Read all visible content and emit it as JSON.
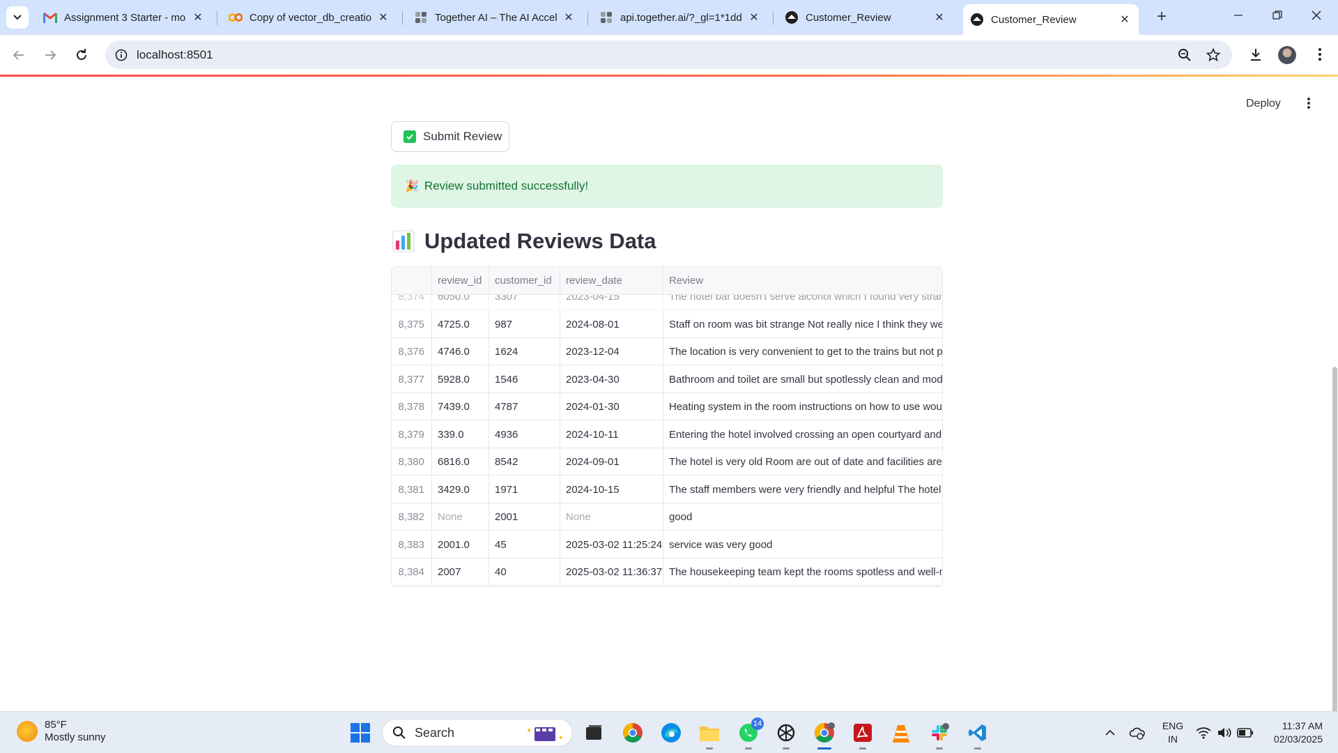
{
  "browser": {
    "tabs": [
      {
        "title": "Assignment 3 Starter - mo",
        "icon": "gmail-icon"
      },
      {
        "title": "Copy of vector_db_creatio",
        "icon": "colab-icon"
      },
      {
        "title": "Together AI – The AI Accel",
        "icon": "together-icon"
      },
      {
        "title": "api.together.ai/?_gl=1*1dd",
        "icon": "together-icon"
      },
      {
        "title": "Customer_Review",
        "icon": "streamlit-icon"
      },
      {
        "title": "Customer_Review",
        "icon": "streamlit-icon",
        "active": true
      }
    ],
    "url": "localhost:8501"
  },
  "app": {
    "deploy_label": "Deploy",
    "submit_label": "Submit Review",
    "success_emoji": "🎉",
    "success_message": "Review submitted successfully!",
    "heading_emoji": "📊",
    "heading": "Updated Reviews Data",
    "accent_color": "#ff4b4b",
    "success_bg": "#dff5e6",
    "success_text_color": "#177233"
  },
  "table": {
    "columns": [
      "",
      "review_id",
      "customer_id",
      "review_date",
      "Review"
    ],
    "rows": [
      {
        "idx": "8,374",
        "review_id": "6050.0",
        "customer_id": "3307",
        "review_date": "2023-04-15",
        "review": "The hotel bar doesn't serve alcohol which I found very strange",
        "partial": true
      },
      {
        "idx": "8,375",
        "review_id": "4725.0",
        "customer_id": "987",
        "review_date": "2024-08-01",
        "review": " Staff on room was bit strange Not really nice I think they were"
      },
      {
        "idx": "8,376",
        "review_id": "4746.0",
        "customer_id": "1624",
        "review_date": "2023-12-04",
        "review": " The location is very convenient to get to the trains but not p"
      },
      {
        "idx": "8,377",
        "review_id": "5928.0",
        "customer_id": "1546",
        "review_date": "2023-04-30",
        "review": " Bathroom and toilet are small but spotlessly clean and mod"
      },
      {
        "idx": "8,378",
        "review_id": "7439.0",
        "customer_id": "4787",
        "review_date": "2024-01-30",
        "review": " Heating system in the room instructions on how to use woul"
      },
      {
        "idx": "8,379",
        "review_id": "339.0",
        "customer_id": "4936",
        "review_date": "2024-10-11",
        "review": " Entering the hotel involved crossing an open courtyard and"
      },
      {
        "idx": "8,380",
        "review_id": "6816.0",
        "customer_id": "8542",
        "review_date": "2024-09-01",
        "review": " The hotel is very old Room are out of date and facilities are r"
      },
      {
        "idx": "8,381",
        "review_id": "3429.0",
        "customer_id": "1971",
        "review_date": "2024-10-15",
        "review": "  The staff members were very friendly and helpful The hotel"
      },
      {
        "idx": "8,382",
        "review_id": "None",
        "customer_id": "2001",
        "review_date": "None",
        "review": "good"
      },
      {
        "idx": "8,383",
        "review_id": "2001.0",
        "customer_id": "45",
        "review_date": "2025-03-02 11:25:24",
        "review": "service was very good"
      },
      {
        "idx": "8,384",
        "review_id": "2007",
        "customer_id": "40",
        "review_date": "2025-03-02 11:36:37",
        "review": "The housekeeping team kept the rooms spotless and well-m"
      }
    ]
  },
  "taskbar": {
    "temperature": "85°F",
    "condition": "Mostly sunny",
    "search_placeholder": "Search",
    "whatsapp_badge": "14",
    "lang_top": "ENG",
    "lang_bottom": "IN",
    "time": "11:37 AM",
    "date": "02/03/2025"
  }
}
